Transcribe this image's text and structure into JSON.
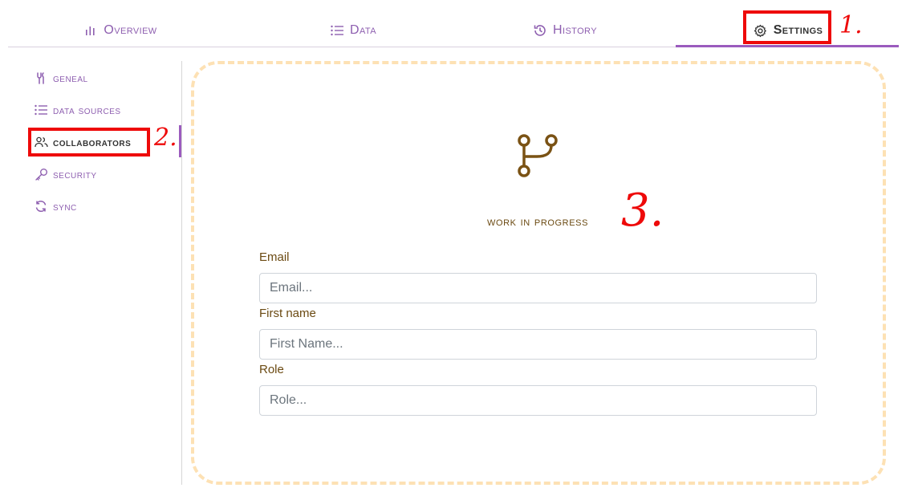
{
  "tabs": [
    {
      "label": "Overview",
      "icon": "bar-chart-icon"
    },
    {
      "label": "Data",
      "icon": "list-icon"
    },
    {
      "label": "History",
      "icon": "history-icon"
    },
    {
      "label": "Settings",
      "icon": "gear-icon",
      "active": true
    }
  ],
  "sidebar": {
    "items": [
      {
        "label": "geneal",
        "icon": "tools-icon"
      },
      {
        "label": "data sources",
        "icon": "list-icon"
      },
      {
        "label": "collaborators",
        "icon": "users-icon",
        "active": true
      },
      {
        "label": "security",
        "icon": "key-icon"
      },
      {
        "label": "sync",
        "icon": "sync-icon"
      }
    ]
  },
  "main": {
    "status_icon": "git-branch-icon",
    "status_text": "work in progress",
    "form": {
      "email": {
        "label": "Email",
        "placeholder": "Email..."
      },
      "first_name": {
        "label": "First name",
        "placeholder": "First Name..."
      },
      "role": {
        "label": "Role",
        "placeholder": "Role..."
      }
    }
  },
  "annotations": {
    "one": "1.",
    "two": "2.",
    "three": "3."
  },
  "colors": {
    "accent": "#9b5bbe",
    "tab_text": "#8e5fb0",
    "active_text": "#333333",
    "brown_text": "#6b4a12",
    "dashed_border": "#fde1b4",
    "annotation_red": "#ee0a0a"
  }
}
